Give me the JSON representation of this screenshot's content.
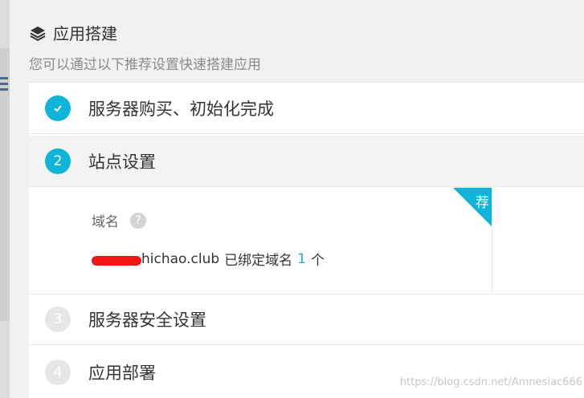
{
  "header": {
    "title": "应用搭建",
    "icon": "layers-icon",
    "subtitle": "您可以通过以下推荐设置快速搭建应用"
  },
  "steps": [
    {
      "number": "✓",
      "label": "服务器购买、初始化完成",
      "state": "done"
    },
    {
      "number": "2",
      "label": "站点设置",
      "state": "active"
    },
    {
      "number": "3",
      "label": "服务器安全设置",
      "state": "pending"
    },
    {
      "number": "4",
      "label": "应用部署",
      "state": "pending"
    }
  ],
  "domain_panel": {
    "label": "域名",
    "help": "?",
    "domain_suffix": "hichao.club",
    "bound_text": "已绑定域名",
    "count": "1",
    "unit": "个",
    "badge": "荐"
  },
  "watermark": "https://blog.csdn.net/Amnesiac666",
  "colors": {
    "accent": "#10b4d8",
    "redaction": "#f01616"
  }
}
